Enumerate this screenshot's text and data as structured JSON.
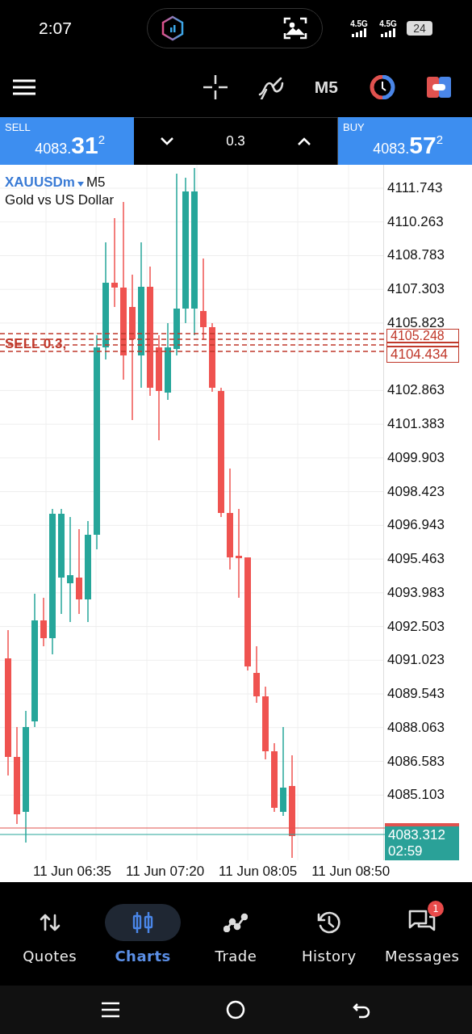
{
  "status_bar": {
    "time": "2:07",
    "networks": [
      "4.5G",
      "4.5G"
    ],
    "battery": "24"
  },
  "toolbar": {
    "timeframe": "M5"
  },
  "trade_panel": {
    "sell": {
      "label": "SELL",
      "price_main": "4083.",
      "price_big": "31",
      "price_sup": "2"
    },
    "volume": "0.3",
    "buy": {
      "label": "BUY",
      "price_main": "4083.",
      "price_big": "57",
      "price_sup": "2"
    }
  },
  "chart": {
    "symbol": "XAUUSDm",
    "timeframe": "M5",
    "description": "Gold vs US Dollar",
    "price_axis": [
      "4111.743",
      "4110.263",
      "4108.783",
      "4107.303",
      "4105.823",
      "4102.863",
      "4101.383",
      "4099.903",
      "4098.423",
      "4096.943",
      "4095.463",
      "4093.983",
      "4092.503",
      "4091.023",
      "4089.543",
      "4088.063",
      "4086.583",
      "4085.103"
    ],
    "order_label": "SELL 0.3,",
    "order_prices": [
      "4105.248",
      "4104.434"
    ],
    "bid_tag": {
      "price": "4083.312",
      "countdown": "02:59"
    },
    "time_axis": [
      "11 Jun 06:35",
      "11 Jun 07:20",
      "11 Jun 08:05",
      "11 Jun 08:50"
    ]
  },
  "nav": [
    {
      "label": "Quotes",
      "selected": false
    },
    {
      "label": "Charts",
      "selected": true
    },
    {
      "label": "Trade",
      "selected": false
    },
    {
      "label": "History",
      "selected": false
    },
    {
      "label": "Messages",
      "selected": false,
      "badge": "1"
    }
  ]
}
